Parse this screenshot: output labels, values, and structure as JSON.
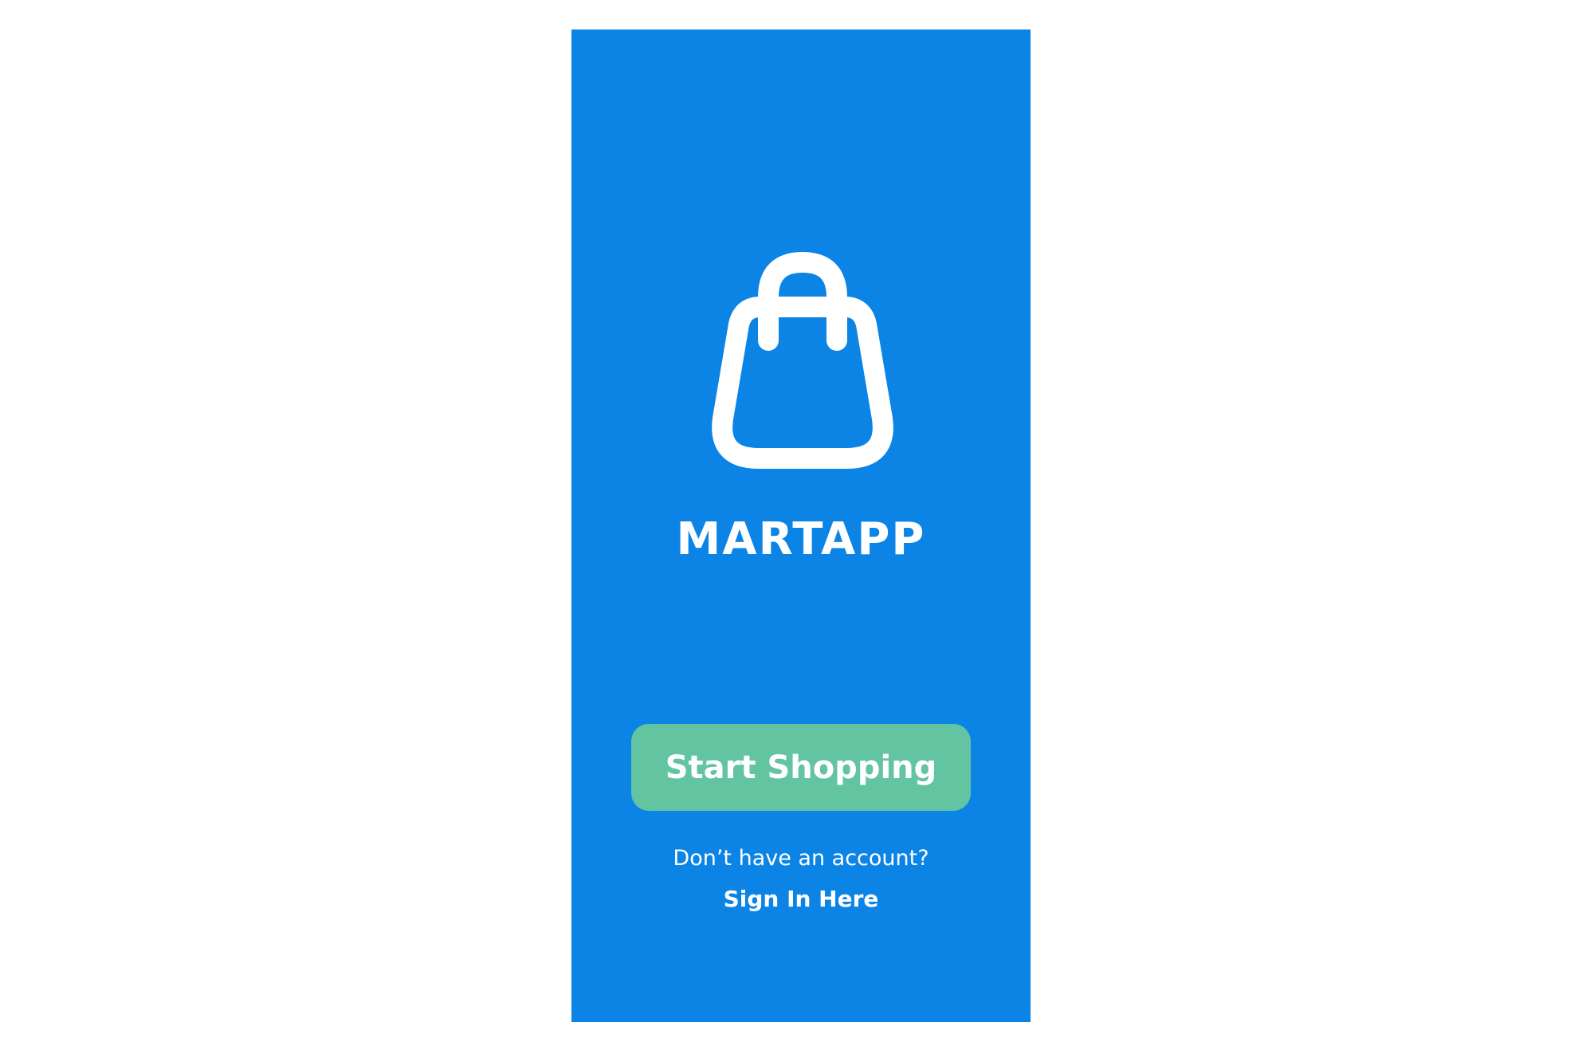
{
  "app": {
    "name": "MARTAPP",
    "logo_icon": "shopping-bag-icon"
  },
  "actions": {
    "start_label": "Start Shopping"
  },
  "account": {
    "prompt": "Don’t have an account?",
    "sign_in_label": "Sign In Here"
  },
  "colors": {
    "background": "#0b84e6",
    "button": "#63c4a1",
    "text": "#ffffff"
  }
}
